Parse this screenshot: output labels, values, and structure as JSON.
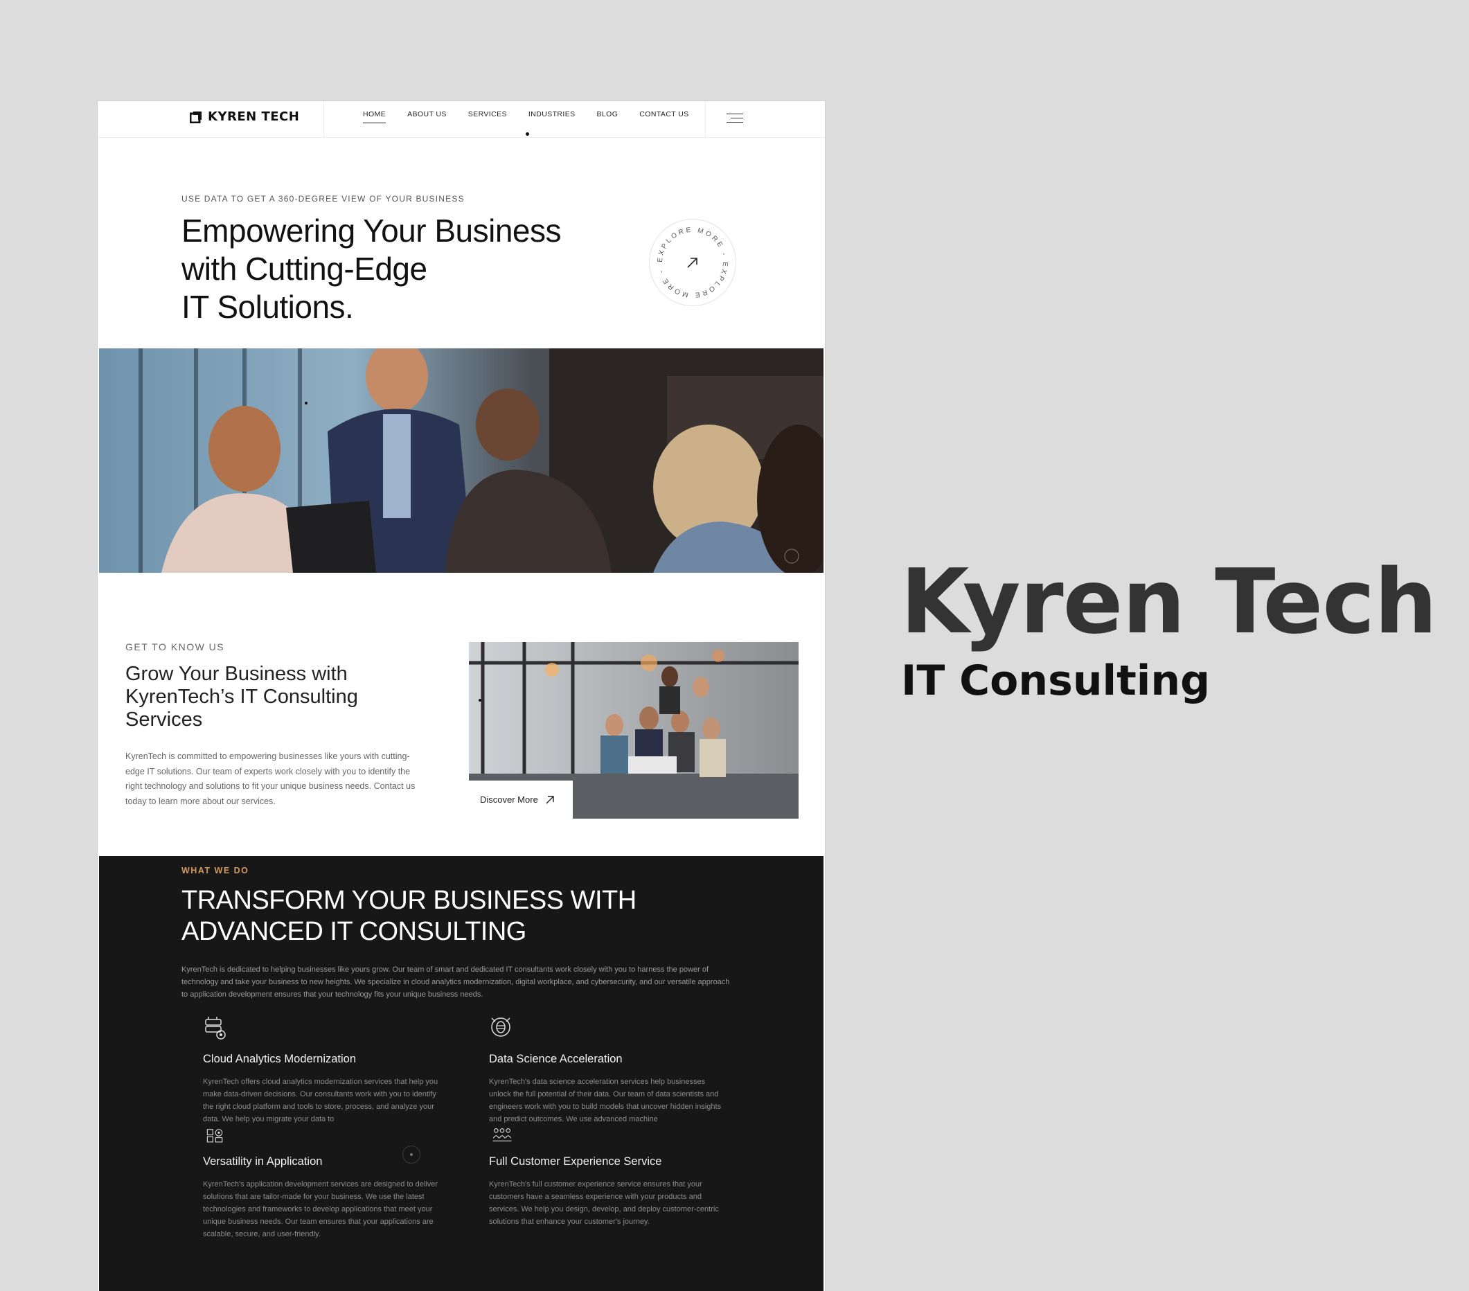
{
  "header": {
    "logo_text": "KYREN TECH",
    "nav": [
      "HOME",
      "ABOUT US",
      "SERVICES",
      "INDUSTRIES",
      "BLOG",
      "CONTACT US"
    ],
    "active_nav": "HOME"
  },
  "hero": {
    "eyebrow": "USE DATA TO GET A 360-DEGREE VIEW OF YOUR BUSINESS",
    "title_lines": [
      "Empowering Your Business",
      "with Cutting-Edge",
      "IT Solutions."
    ],
    "explore_ring_text": "EXPLORE MORE - EXPLORE MORE -"
  },
  "about": {
    "eyebrow": "GET TO KNOW US",
    "title": "Grow Your Business with KyrenTech’s IT Consulting Services",
    "text": "KyrenTech is committed to empowering businesses like yours with cutting-edge IT solutions. Our team of experts work closely with you to identify the right technology and solutions to fit your unique business needs. Contact us today to learn more about our services.",
    "button_label": "Discover More"
  },
  "services": {
    "eyebrow": "WHAT WE DO",
    "title_lines": [
      "TRANSFORM YOUR BUSINESS WITH",
      "ADVANCED IT CONSULTING"
    ],
    "intro": "KyrenTech is dedicated to helping businesses like yours grow. Our team of smart and dedicated IT consultants work closely with you to harness the power of technology and take your business to new heights. We specialize in cloud analytics modernization, digital workplace, and cybersecurity, and our versatile approach to application development ensures that your technology fits your unique business needs.",
    "items": [
      {
        "title": "Cloud Analytics Modernization",
        "text": "KyrenTech offers cloud analytics modernization services that help you make data-driven decisions. Our consultants work with you to identify the right cloud platform and tools to store, process, and analyze your data. We help you migrate your data to",
        "icon": "cloud-analytics-icon"
      },
      {
        "title": "Data Science Acceleration",
        "text": "KyrenTech's data science acceleration services help businesses unlock the full potential of their data. Our team of data scientists and engineers work with you to build models that uncover hidden insights and predict outcomes. We use advanced machine",
        "icon": "data-science-icon"
      },
      {
        "title": "Versatility in Application",
        "text": "KyrenTech's application development services are designed to deliver solutions that are tailor-made for your business. We use the latest technologies and frameworks to develop applications that meet your unique business needs. Our team ensures that your applications are scalable, secure, and user-friendly.",
        "icon": "application-icon"
      },
      {
        "title": "Full Customer Experience Service",
        "text": "KyrenTech's full customer experience service ensures that your customers have a seamless experience with your products and services. We help you design, develop, and deploy customer-centric solutions that enhance your customer's journey.",
        "icon": "customer-group-icon"
      }
    ]
  },
  "promo": {
    "title": "Kyren Tech",
    "subtitle": "IT Consulting"
  },
  "colors": {
    "page_bg": "#dcdcdc",
    "dark_section": "#171717",
    "accent": "#d39a5a"
  }
}
